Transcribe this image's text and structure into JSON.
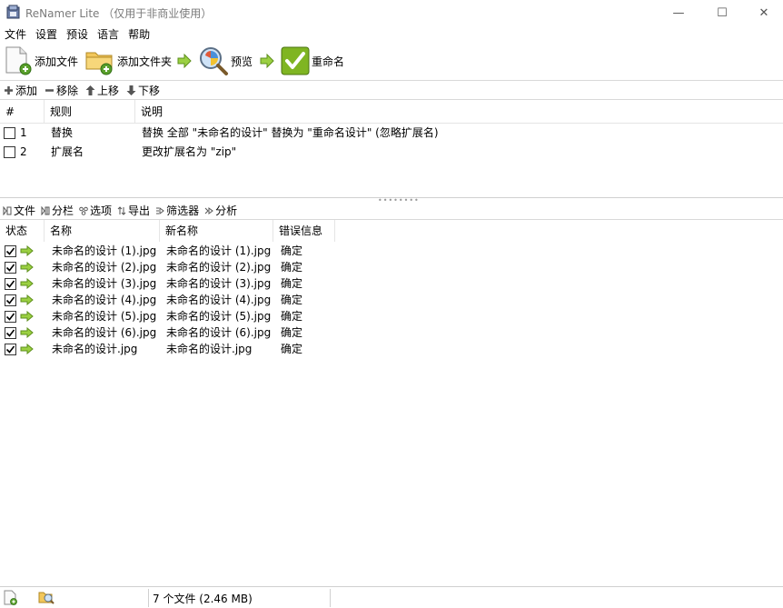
{
  "window": {
    "title": "ReNamer Lite （仅用于非商业使用）",
    "min_glyph": "—",
    "max_glyph": "☐",
    "close_glyph": "✕"
  },
  "menu": [
    "文件",
    "设置",
    "预设",
    "语言",
    "帮助"
  ],
  "toolbar": {
    "add_files": "添加文件",
    "add_folder": "添加文件夹",
    "preview": "预览",
    "rename": "重命名"
  },
  "rules_toolbar": {
    "add": "添加",
    "remove": "移除",
    "move_up": "上移",
    "move_down": "下移"
  },
  "rules_table": {
    "headers": [
      "#",
      "规则",
      "说明"
    ],
    "rows": [
      {
        "num": "1",
        "rule": "替换",
        "desc": "替换 全部 \"未命名的设计\" 替换为 \"重命名设计\" (忽略扩展名)",
        "checked": false
      },
      {
        "num": "2",
        "rule": "扩展名",
        "desc": "更改扩展名为 \"zip\"",
        "checked": false
      }
    ]
  },
  "files_toolbar": {
    "files": "文件",
    "columns": "分栏",
    "options": "选项",
    "export": "导出",
    "filter": "筛选器",
    "analyze": "分析"
  },
  "files_table": {
    "headers": [
      "状态",
      "名称",
      "新名称",
      "错误信息"
    ],
    "rows": [
      {
        "name": "未命名的设计 (1).jpg",
        "new_name": "未命名的设计 (1).jpg",
        "error": "确定",
        "checked": true
      },
      {
        "name": "未命名的设计 (2).jpg",
        "new_name": "未命名的设计 (2).jpg",
        "error": "确定",
        "checked": true
      },
      {
        "name": "未命名的设计 (3).jpg",
        "new_name": "未命名的设计 (3).jpg",
        "error": "确定",
        "checked": true
      },
      {
        "name": "未命名的设计 (4).jpg",
        "new_name": "未命名的设计 (4).jpg",
        "error": "确定",
        "checked": true
      },
      {
        "name": "未命名的设计 (5).jpg",
        "new_name": "未命名的设计 (5).jpg",
        "error": "确定",
        "checked": true
      },
      {
        "name": "未命名的设计 (6).jpg",
        "new_name": "未命名的设计 (6).jpg",
        "error": "确定",
        "checked": true
      },
      {
        "name": "未命名的设计.jpg",
        "new_name": "未命名的设计.jpg",
        "error": "确定",
        "checked": true
      }
    ]
  },
  "status": {
    "file_count": "7 个文件 (2.46 MB)"
  },
  "colors": {
    "accent_green": "#7fb522",
    "separator": "#d9d9d9"
  }
}
